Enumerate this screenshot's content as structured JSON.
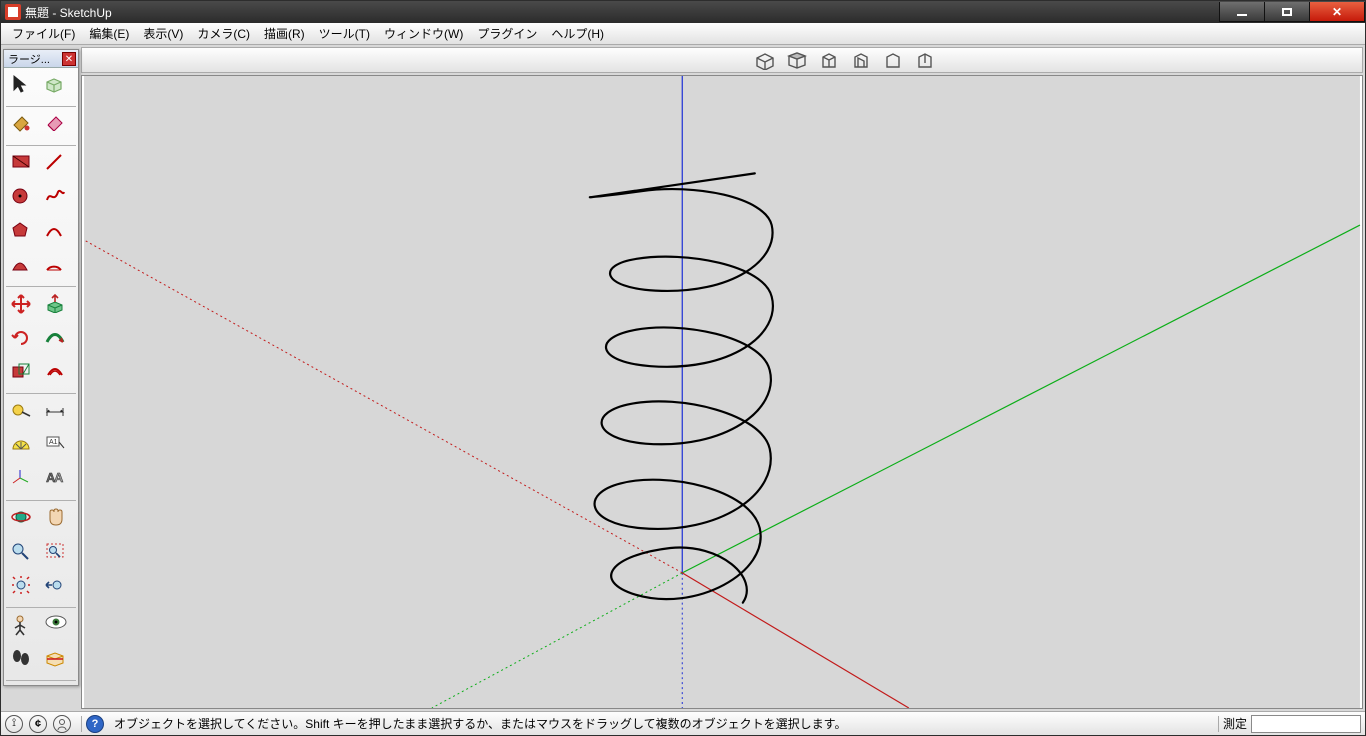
{
  "window": {
    "title": "無題 - SketchUp"
  },
  "menu": {
    "items": [
      "ファイル(F)",
      "編集(E)",
      "表示(V)",
      "カメラ(C)",
      "描画(R)",
      "ツール(T)",
      "ウィンドウ(W)",
      "プラグイン",
      "ヘルプ(H)"
    ]
  },
  "toolbox": {
    "title": "ラージ..."
  },
  "tool_names": [
    "select-tool",
    "make-component-tool",
    "paint-bucket-tool",
    "eraser-tool",
    "rectangle-tool",
    "line-tool",
    "circle-tool",
    "freehand-tool",
    "polygon-tool",
    "arc-tool",
    "arc2-tool",
    "pie-tool",
    "move-tool",
    "push-pull-tool",
    "rotate-tool",
    "follow-me-tool",
    "scale-tool",
    "offset-tool",
    "tape-measure-tool",
    "dimension-tool",
    "protractor-tool",
    "text-tool",
    "axes-tool",
    "3d-text-tool",
    "orbit-tool",
    "pan-tool",
    "zoom-tool",
    "zoom-window-tool",
    "zoom-extents-tool",
    "previous-view-tool",
    "position-camera-tool",
    "look-around-tool",
    "walk-tool",
    "section-plane-tool"
  ],
  "status": {
    "message": "オブジェクトを選択してください。Shift キーを押したまま選択するか、またはマウスをドラッグして複数のオブジェクトを選択します。",
    "label": "測定"
  }
}
